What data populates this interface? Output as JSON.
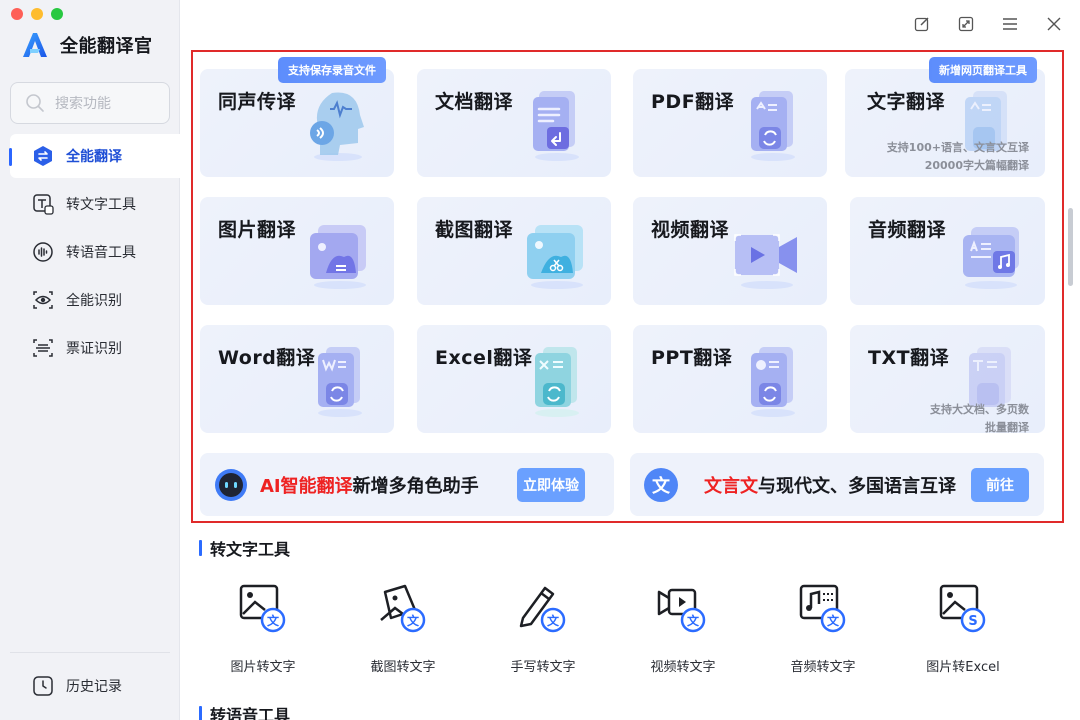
{
  "app": {
    "name": "全能翻译官",
    "search_placeholder": "搜索功能"
  },
  "sidebar": {
    "items": [
      {
        "label": "全能翻译",
        "icon": "translate-icon",
        "active": true
      },
      {
        "label": "转文字工具",
        "icon": "text-convert-icon",
        "active": false
      },
      {
        "label": "转语音工具",
        "icon": "voice-icon",
        "active": false
      },
      {
        "label": "全能识别",
        "icon": "eye-scan-icon",
        "active": false
      },
      {
        "label": "票证识别",
        "icon": "scan-frame-icon",
        "active": false
      }
    ],
    "history_label": "历史记录"
  },
  "cards": [
    {
      "title": "同声传译",
      "badge": "支持保存录音文件"
    },
    {
      "title": "文档翻译"
    },
    {
      "title": "PDF翻译"
    },
    {
      "title": "文字翻译",
      "badge": "新增网页翻译工具",
      "note_line1": "支持100+语言、文言文互译",
      "note_line2": "20000字大篇幅翻译"
    },
    {
      "title": "图片翻译"
    },
    {
      "title": "截图翻译"
    },
    {
      "title": "视频翻译"
    },
    {
      "title": "音频翻译"
    },
    {
      "title": "Word翻译"
    },
    {
      "title": "Excel翻译"
    },
    {
      "title": "PPT翻译"
    },
    {
      "title": "TXT翻译",
      "note_line1": "支持大文档、多页数",
      "note_line2": "批量翻译"
    }
  ],
  "banners": {
    "ai": {
      "highlight": "AI智能翻译",
      "text": "新增多角色助手",
      "button": "立即体验"
    },
    "classical": {
      "icon_char": "文",
      "highlight": "文言文",
      "text": "与现代文、多国语言互译",
      "button": "前往"
    }
  },
  "sections": {
    "text_tools_title": "转文字工具",
    "voice_tools_title": "转语音工具"
  },
  "text_tools": [
    {
      "label": "图片转文字",
      "icon": "image-to-text-icon"
    },
    {
      "label": "截图转文字",
      "icon": "screenshot-to-text-icon"
    },
    {
      "label": "手写转文字",
      "icon": "handwriting-to-text-icon"
    },
    {
      "label": "视频转文字",
      "icon": "video-to-text-icon"
    },
    {
      "label": "音频转文字",
      "icon": "audio-to-text-icon"
    },
    {
      "label": "图片转Excel",
      "icon": "image-to-excel-icon"
    }
  ],
  "colors": {
    "accent": "#2b6bff",
    "highlight_red": "#ee2222",
    "frame_red": "#e02a2a"
  }
}
